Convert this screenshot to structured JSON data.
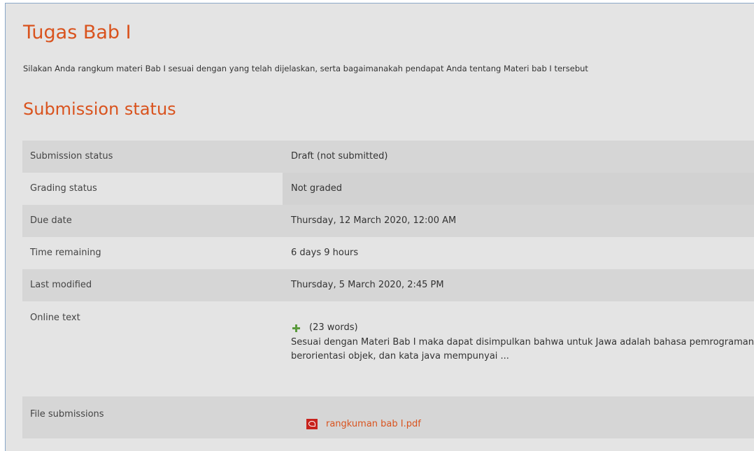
{
  "assignment": {
    "title": "Tugas Bab I",
    "intro": "Silakan Anda rangkum materi Bab I sesuai dengan yang telah dijelaskan, serta bagaimanakah pendapat Anda tentang Materi bab I tersebut"
  },
  "section_heading": "Submission status",
  "rows": [
    {
      "label": "Submission status",
      "value": "Draft (not submitted)"
    },
    {
      "label": "Grading status",
      "value": "Not graded"
    },
    {
      "label": "Due date",
      "value": "Thursday, 12 March 2020, 12:00 AM"
    },
    {
      "label": "Time remaining",
      "value": "6 days 9 hours"
    },
    {
      "label": "Last modified",
      "value": "Thursday, 5 March 2020, 2:45 PM"
    }
  ],
  "online_text": {
    "label": "Online text",
    "expand_icon": "plus-icon",
    "word_count": "(23 words)",
    "excerpt": "Sesuai dengan Materi Bab I maka dapat disimpulkan bahwa untuk Jawa adalah bahasa pemrograman yang berorientasi objek, dan kata java mempunyai ..."
  },
  "file_submissions": {
    "label": "File submissions",
    "file_icon": "pdf-icon",
    "file_name": "rangkuman bab I.pdf"
  },
  "colors": {
    "heading": "#d9531e",
    "link": "#d9531e",
    "expand_icon": "#5a9a3c",
    "pdf_icon": "#c8231d"
  }
}
